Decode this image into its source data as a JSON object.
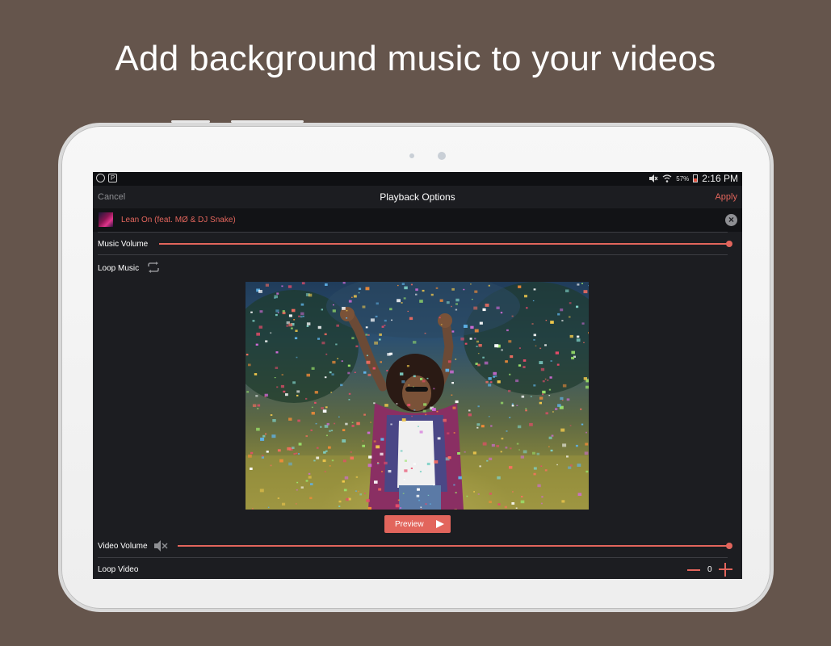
{
  "headline": "Add background music to your videos",
  "status_bar": {
    "battery_percent": "57%",
    "time": "2:16 PM",
    "left_icons": [
      "circle-status-icon",
      "p-notification-icon"
    ],
    "right_icons": [
      "mute-icon",
      "wifi-icon",
      "battery-icon"
    ]
  },
  "toolbar": {
    "cancel_label": "Cancel",
    "title": "Playback Options",
    "apply_label": "Apply"
  },
  "track": {
    "title": "Lean On (feat. MØ & DJ Snake)",
    "clear_icon": "close-circle-icon"
  },
  "music_volume": {
    "label": "Music Volume",
    "value": 1.0
  },
  "loop_music": {
    "label": "Loop Music",
    "icon": "repeat-icon"
  },
  "preview": {
    "label": "Preview",
    "icon": "play-icon"
  },
  "video_volume": {
    "label": "Video Volume",
    "value": 1.0,
    "icon": "speaker-muted-icon"
  },
  "loop_video": {
    "label": "Loop Video",
    "count": "0"
  },
  "colors": {
    "accent": "#e2655c",
    "background": "#65554c",
    "screen": "#1c1d21",
    "muted_text": "#8e8f93"
  }
}
